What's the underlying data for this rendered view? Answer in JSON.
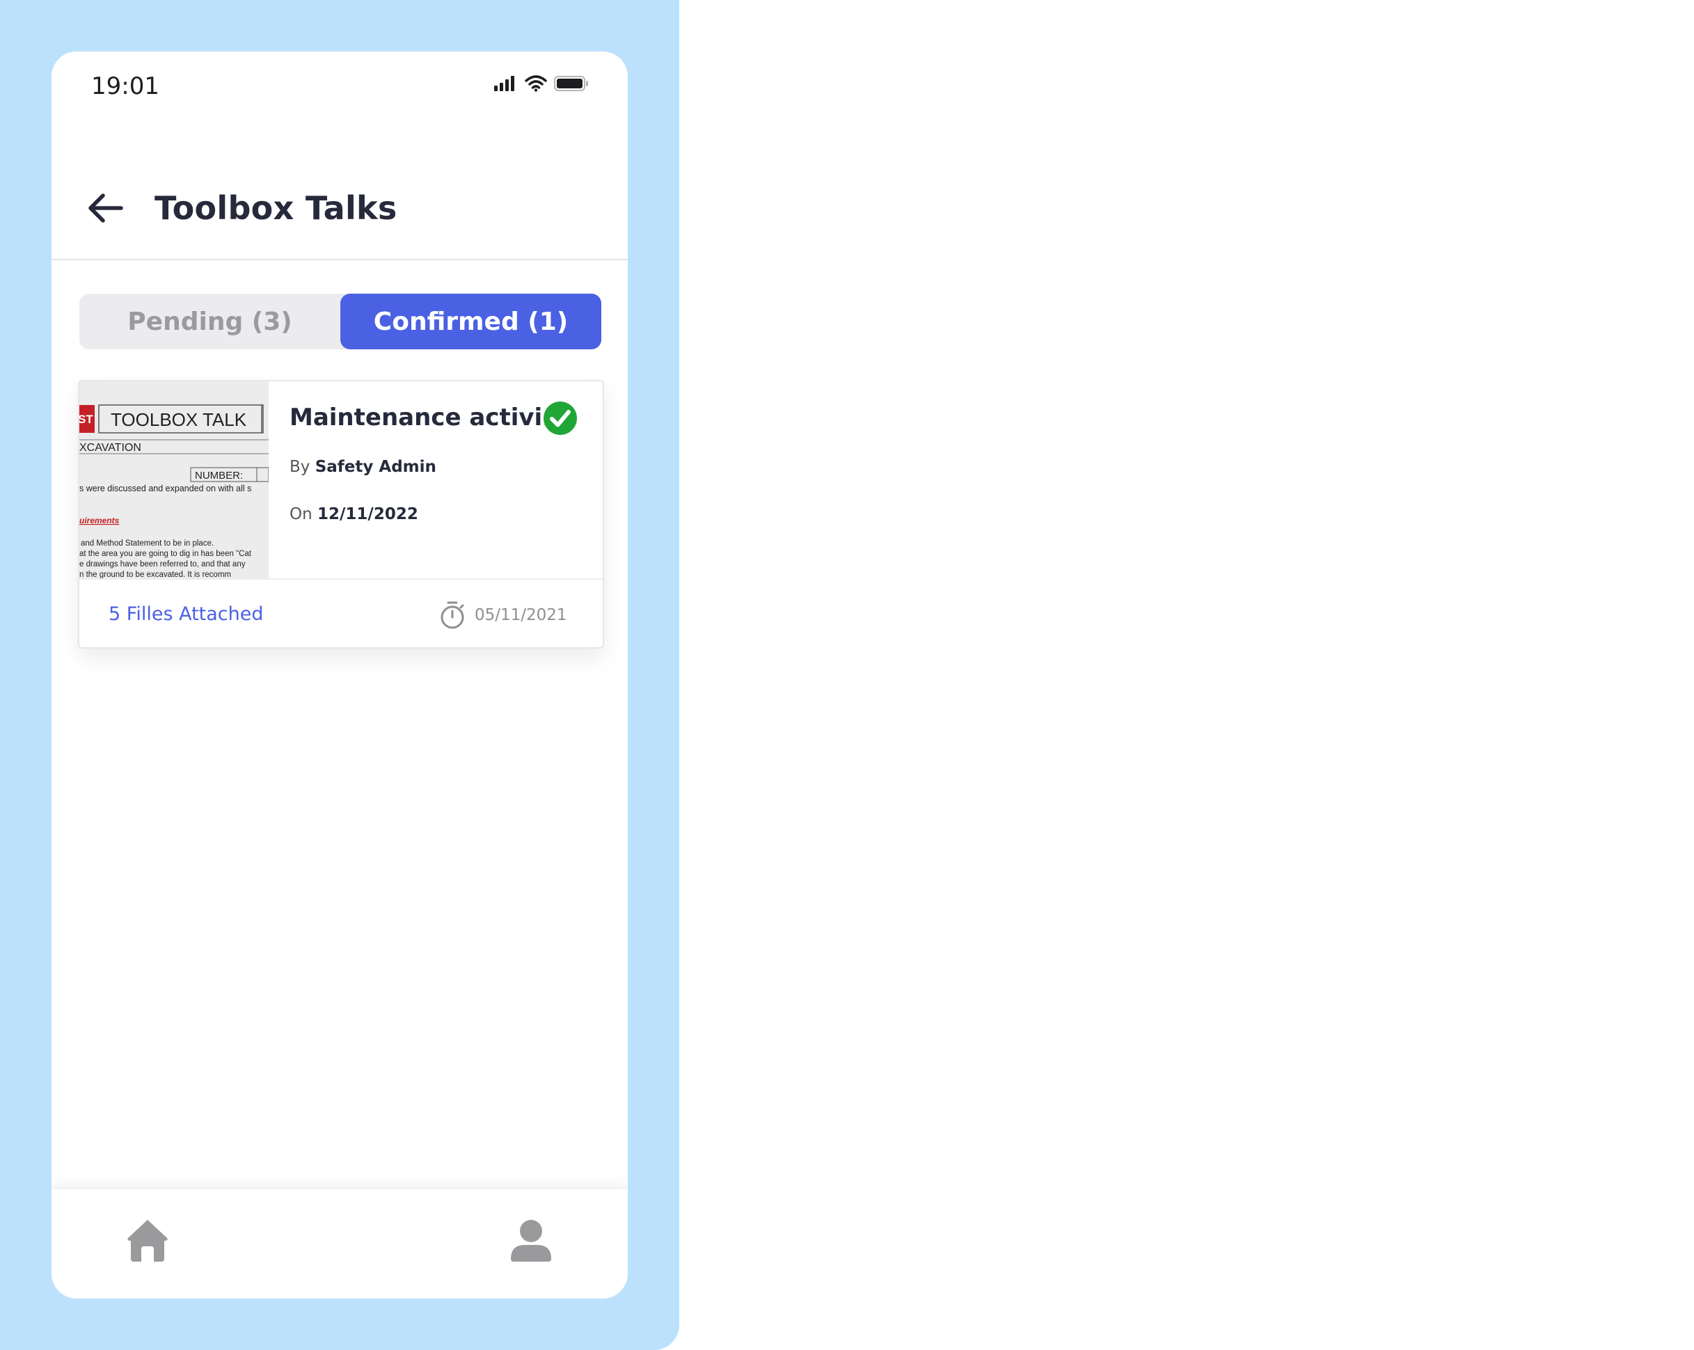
{
  "status_bar": {
    "time": "19:01",
    "icons": [
      "signal-icon",
      "wifi-icon",
      "battery-icon"
    ]
  },
  "header": {
    "title": "Toolbox Talks",
    "back_icon": "arrow-left-icon"
  },
  "tabs": {
    "pending": "Pending (3)",
    "confirmed": "Confirmed (1)",
    "active": "confirmed"
  },
  "talks": [
    {
      "title": "Maintenance activi...",
      "status_icon": "check-circle-icon",
      "by_label": "By",
      "author": "Safety Admin",
      "on_label": "On",
      "date": "12/11/2022",
      "files": "5 Filles Attached",
      "timer_icon": "stopwatch-icon",
      "due_date": "05/11/2021",
      "thumbnail": {
        "badge": "ST",
        "heading": "TOOLBOX TALK",
        "subject": "XCAVATION",
        "number_label": "NUMBER:",
        "line1": "s were discussed and expanded on with all s",
        "section": "uirements",
        "line2": "and Method Statement to be in place.",
        "line3": "at the area you are going to dig in has been \"Cat",
        "line4": "e drawings have been referred to, and that any",
        "line5": "n  the  ground  to  be  excavated.  It  is  recomm"
      }
    }
  ],
  "bottom_nav": {
    "items": [
      "home-icon",
      "profile-icon"
    ]
  },
  "colors": {
    "background": "#bce1fd",
    "accent": "#4a61e3",
    "success": "#1fa637",
    "text": "#262a3b"
  }
}
